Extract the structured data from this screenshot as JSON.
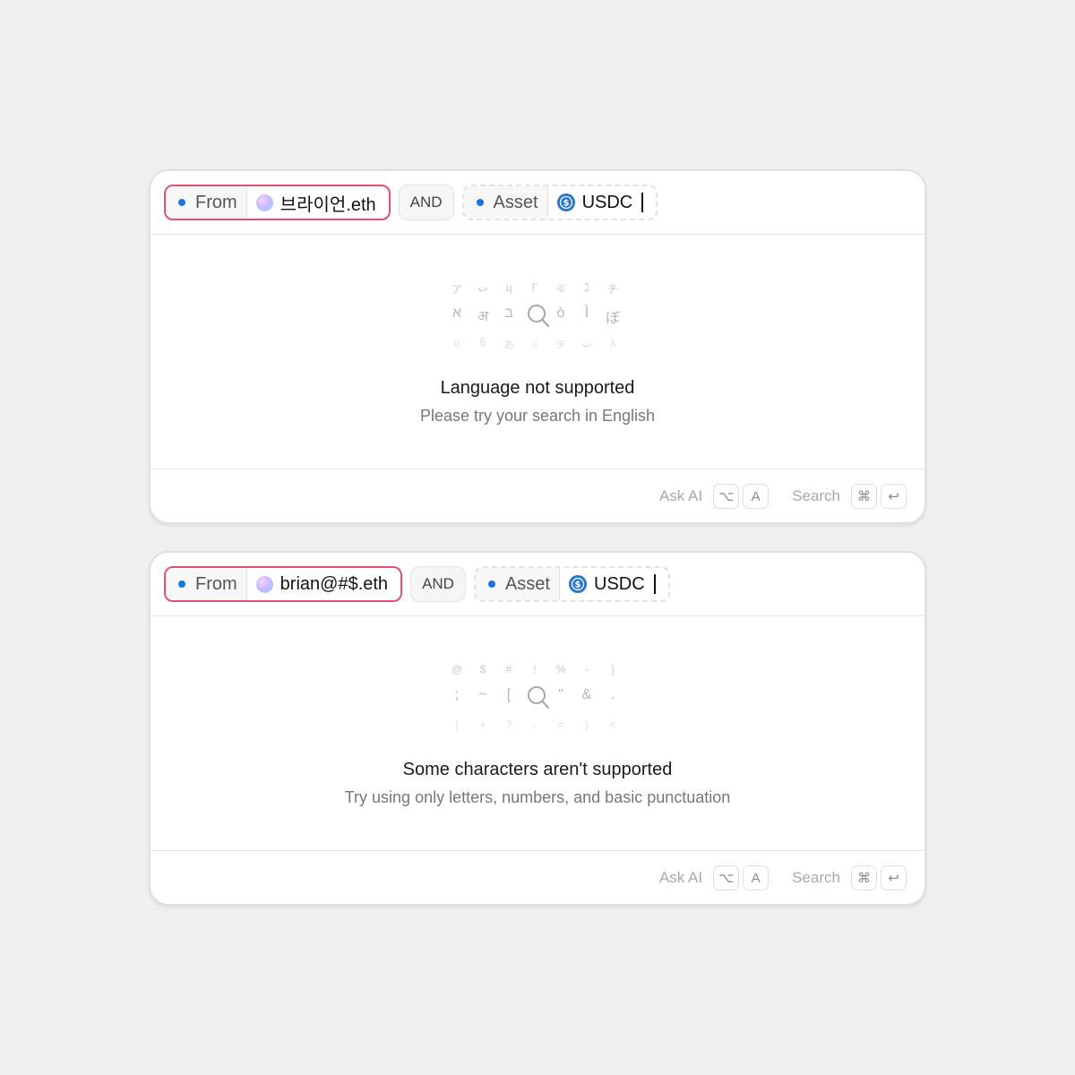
{
  "cards": [
    {
      "filter1": {
        "key": "From",
        "value": "브라이언.eth"
      },
      "operator": "AND",
      "filter2": {
        "key": "Asset",
        "value": "USDC"
      },
      "glyphs": [
        "ア",
        "ت",
        "ц",
        "Г",
        "ঝ",
        "ℷ",
        "チ",
        "א",
        "अ",
        "ב",
        "ò",
        "Ì",
        "ぼ",
        "ü",
        "ნ",
        "あ",
        "ব",
        "チ",
        "ب",
        "λ"
      ],
      "message_title": "Language not supported",
      "message_sub": "Please try your search in English"
    },
    {
      "filter1": {
        "key": "From",
        "value": "brian@#$.eth"
      },
      "operator": "AND",
      "filter2": {
        "key": "Asset",
        "value": "USDC"
      },
      "glyphs": [
        "@",
        "$",
        "#",
        "!",
        "%",
        "-",
        "}",
        ";",
        "~",
        "[",
        "\"",
        "&",
        ".",
        "|",
        "+",
        "?",
        ".",
        "=",
        ")",
        "<"
      ],
      "message_title": "Some characters aren't supported",
      "message_sub": "Try using only letters, numbers, and basic punctuation"
    }
  ],
  "footer": {
    "ask_ai_label": "Ask AI",
    "ask_ai_keys": [
      "⌥",
      "A"
    ],
    "search_label": "Search",
    "search_keys": [
      "⌘",
      "↩"
    ]
  },
  "colors": {
    "error_border": "#e0506f",
    "dot_blue": "#1a73e8",
    "usdc_blue": "#2775ca"
  },
  "icons": {
    "filter_dot": "dot-icon",
    "avatar": "avatar-icon",
    "asset": "usdc-icon",
    "search": "search-icon"
  }
}
